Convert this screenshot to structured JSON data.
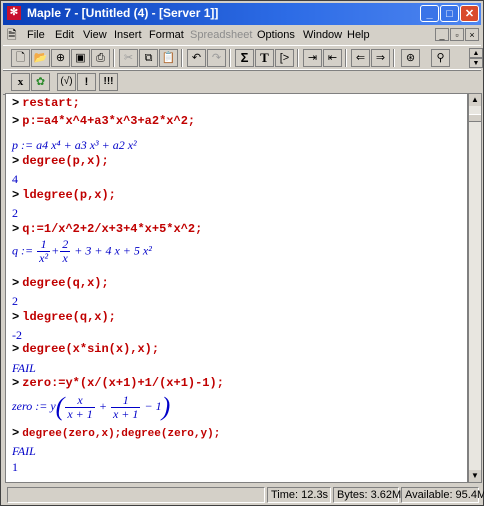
{
  "window": {
    "title": "Maple 7 - [Untitled (4) - [Server 1]]",
    "app_icon": "maple-leaf-icon",
    "buttons": {
      "minimize": "_",
      "maximize": "□",
      "close": "✕"
    }
  },
  "menu": {
    "items": [
      "File",
      "Edit",
      "View",
      "Insert",
      "Format",
      "Spreadsheet",
      "Options",
      "Window",
      "Help"
    ],
    "disabled": [
      "Spreadsheet"
    ]
  },
  "toolbar1": {
    "buttons": [
      "new-icon",
      "open-icon",
      "open-url-icon",
      "save-icon",
      "print-icon",
      "cut-icon",
      "copy-icon",
      "paste-icon",
      "undo-icon",
      "redo-icon",
      "sigma-icon",
      "text-icon",
      "execution-group-icon",
      "indent-icon",
      "outdent-icon",
      "back-icon",
      "forward-icon",
      "stop-icon",
      "restart-icon"
    ],
    "sigma_label": "Σ",
    "text_label": "T"
  },
  "toolbar2": {
    "buttons": [
      "math-input-icon",
      "maple-input-icon",
      "function-icon",
      "exclamation-icon",
      "execute-all-icon"
    ],
    "math_label": "x",
    "func_label": "(√)",
    "exec_label": "!",
    "execall_label": "!!!"
  },
  "worksheet": {
    "lines": {
      "l1_prompt": ">",
      "l1_cmd": "restart;",
      "l2_prompt": ">",
      "l2_cmd": "p:=a4*x^4+a3*x^3+a2*x^2;",
      "l3_out": "p := a4 x⁴ + a3 x³ + a2 x²",
      "l4_prompt": ">",
      "l4_cmd": "degree(p,x);",
      "l5_out": "4",
      "l6_prompt": ">",
      "l6_cmd": "ldegree(p,x);",
      "l7_out": "2",
      "l8_prompt": ">",
      "l8_cmd": "q:=1/x^2+2/x+3+4*x+5*x^2;",
      "l9_lhs": "q :=",
      "l9_f1_num": "1",
      "l9_f1_den": "x²",
      "l9_plus1": "+",
      "l9_f2_num": "2",
      "l9_f2_den": "x",
      "l9_rest": "+ 3 + 4 x + 5 x²",
      "l10_prompt": ">",
      "l10_cmd": "degree(q,x);",
      "l11_out": "2",
      "l12_prompt": ">",
      "l12_cmd": "ldegree(q,x);",
      "l13_out": "-2",
      "l14_prompt": ">",
      "l14_cmd": "degree(x*sin(x),x);",
      "l15_out": "FAIL",
      "l16_prompt": ">",
      "l16_cmd": "zero:=y*(x/(x+1)+1/(x+1)-1);",
      "l17_lhs": "zero := y",
      "l17_f1_num": "x",
      "l17_f1_den": "x + 1",
      "l17_plus": "+",
      "l17_f2_num": "1",
      "l17_f2_den": "x + 1",
      "l17_minus": "− 1",
      "l18_prompt": ">",
      "l18_cmd": "degree(zero,x);degree(zero,y);",
      "l19_out": "FAIL",
      "l20_out": "1"
    }
  },
  "status": {
    "time": "Time: 12.3s",
    "bytes": "Bytes: 3.62M",
    "available": "Available: 95.4M"
  }
}
